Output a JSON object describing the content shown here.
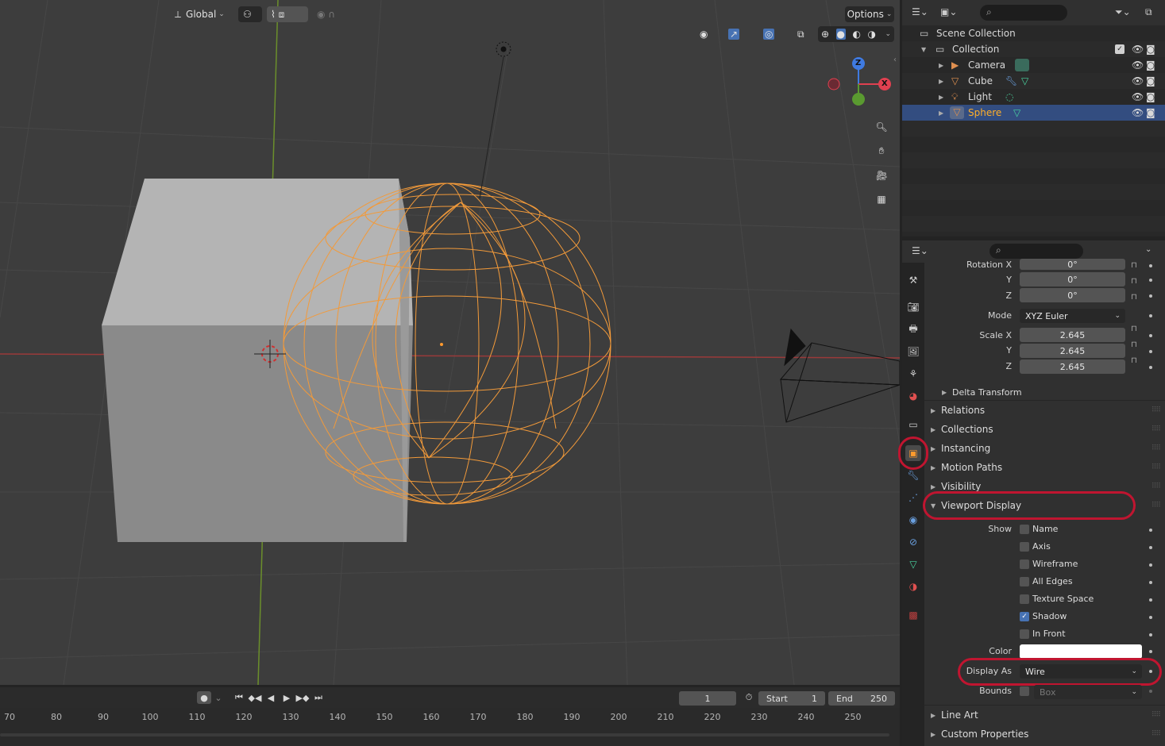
{
  "viewport_header": {
    "orientation": "Global",
    "options_label": "Options"
  },
  "gizmo": {
    "z": "Z",
    "x": "X"
  },
  "timeline": {
    "current_frame": "1",
    "start_label": "Start",
    "start_value": "1",
    "end_label": "End",
    "end_value": "250",
    "ticks": [
      "70",
      "80",
      "90",
      "100",
      "110",
      "120",
      "130",
      "140",
      "150",
      "160",
      "170",
      "180",
      "190",
      "200",
      "210",
      "220",
      "230",
      "240",
      "250"
    ]
  },
  "outliner": {
    "scene_collection": "Scene Collection",
    "collection": "Collection",
    "items": [
      {
        "name": "Camera"
      },
      {
        "name": "Cube"
      },
      {
        "name": "Light"
      },
      {
        "name": "Sphere"
      }
    ]
  },
  "properties": {
    "rotation_x_label": "Rotation X",
    "rotation_x": "0°",
    "y_label": "Y",
    "z_label": "Z",
    "rotation_y": "0°",
    "rotation_z": "0°",
    "mode_label": "Mode",
    "mode_value": "XYZ Euler",
    "scale_x_label": "Scale X",
    "scale_x": "2.645",
    "scale_y": "2.645",
    "scale_z": "2.645",
    "delta_transform": "Delta Transform",
    "panels": {
      "relations": "Relations",
      "collections": "Collections",
      "instancing": "Instancing",
      "motion_paths": "Motion Paths",
      "visibility": "Visibility",
      "viewport_display": "Viewport Display",
      "line_art": "Line Art",
      "custom_properties": "Custom Properties"
    },
    "show_label": "Show",
    "show_options": [
      {
        "label": "Name",
        "checked": false
      },
      {
        "label": "Axis",
        "checked": false
      },
      {
        "label": "Wireframe",
        "checked": false
      },
      {
        "label": "All Edges",
        "checked": false
      },
      {
        "label": "Texture Space",
        "checked": false
      },
      {
        "label": "Shadow",
        "checked": true
      },
      {
        "label": "In Front",
        "checked": false
      }
    ],
    "color_label": "Color",
    "color_value": "#ffffff",
    "display_as_label": "Display As",
    "display_as_value": "Wire",
    "bounds_label": "Bounds",
    "bounds_value": "Box"
  },
  "colors": {
    "selection": "#ff9a2e",
    "highlight_ring": "#c01530",
    "selected_row": "#334d80",
    "checkbox_on": "#4772b3"
  }
}
